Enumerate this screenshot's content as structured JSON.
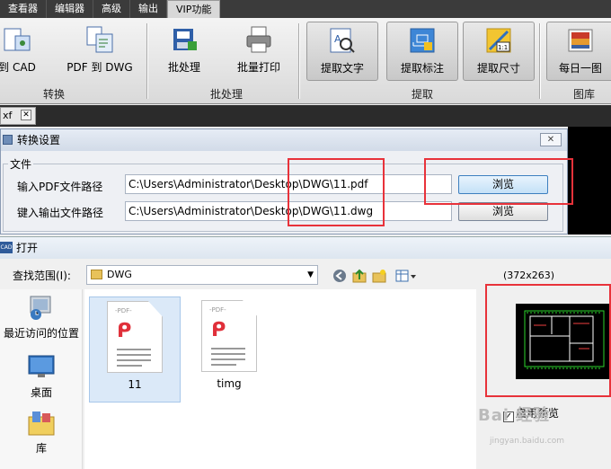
{
  "ribbon_tabs": [
    "查看器",
    "编辑器",
    "高级",
    "输出",
    "VIP功能"
  ],
  "active_tab_index": 4,
  "ribbon": {
    "buttons": {
      "cad": "到 CAD",
      "pdf_to_dwg": "PDF 到 DWG",
      "batch": "批处理",
      "batch_print": "批量打印",
      "extract_text": "提取文字",
      "extract_annot": "提取标注",
      "extract_dims": "提取尺寸",
      "daily_pic": "每日一图"
    },
    "groups": {
      "convert": "转换",
      "batch": "批处理",
      "extract": "提取",
      "gallery": "图库"
    }
  },
  "doc_tab": {
    "label": "xf",
    "close": "✕"
  },
  "convert_dialog": {
    "title": "转换设置",
    "close": "✕",
    "group": "文件",
    "input_label": "输入PDF文件路径",
    "input_value": "C:\\Users\\Administrator\\Desktop\\DWG\\11.pdf",
    "output_label": "键入输出文件路径",
    "output_value": "C:\\Users\\Administrator\\Desktop\\DWG\\11.dwg",
    "browse": "浏览"
  },
  "open_dialog": {
    "title": "打开",
    "app_icon": "CAD",
    "look_in_label": "查找范围(I):",
    "look_in_value": "DWG",
    "preview_size": "(372x263)",
    "places": [
      "最近访问的位置",
      "桌面",
      "库"
    ],
    "files": [
      "11",
      "timg"
    ],
    "file_tag": "-PDF-",
    "enable_preview": "启用预览"
  },
  "watermark": {
    "main": "Bai 经验",
    "sub": "jingyan.baidu.com"
  },
  "colors": {
    "highlight_border": "#e8323a",
    "ribbon_tab_bg": "#3b3b3b",
    "pdf_red": "#e0303a"
  }
}
